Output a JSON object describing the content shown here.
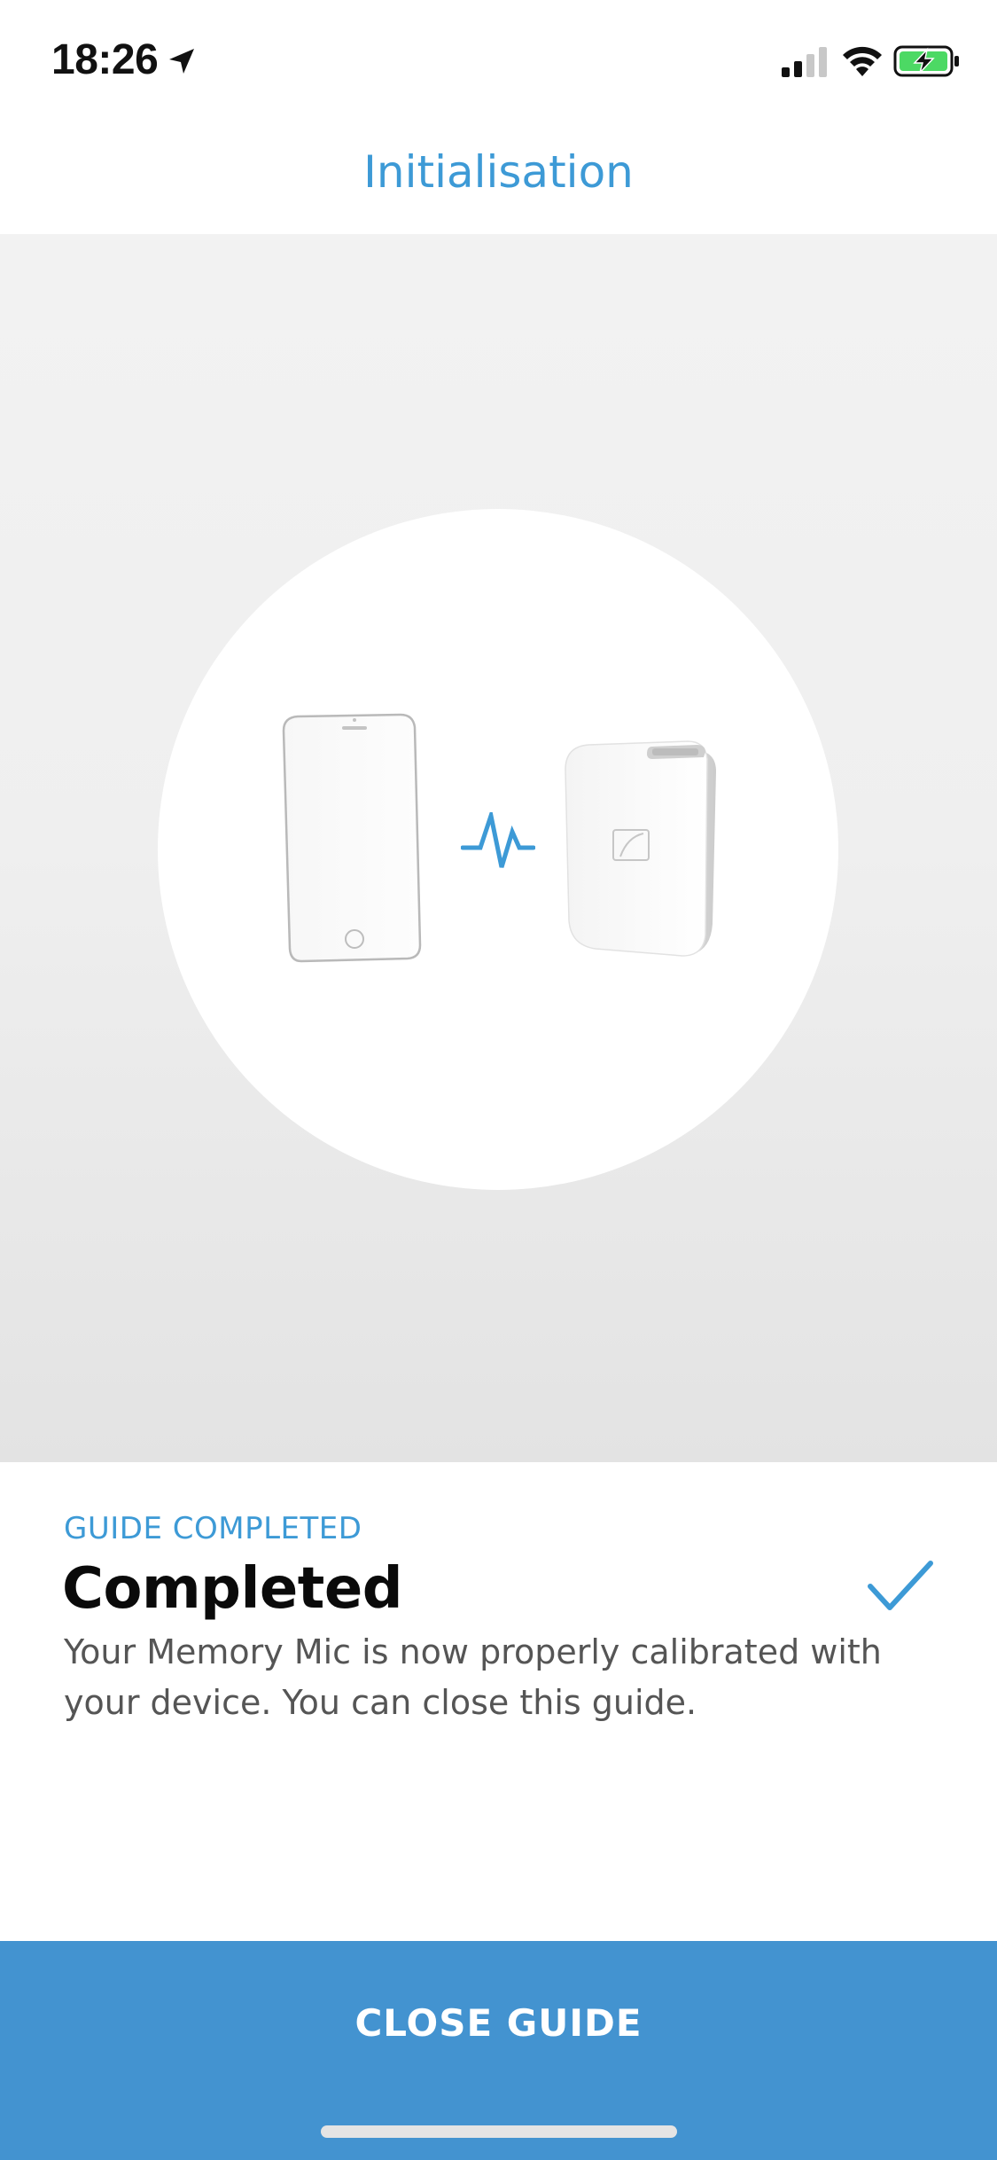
{
  "status_bar": {
    "time": "18:26"
  },
  "header": {
    "title": "Initialisation"
  },
  "illustration": {
    "icons": [
      "phone-illustration",
      "connection-icon",
      "memory-mic-illustration"
    ]
  },
  "guide": {
    "step_label": "GUIDE COMPLETED",
    "title": "Completed",
    "description": "Your Memory Mic is now properly calibrated with your device. You can close this guide.",
    "status_icon": "checkmark-icon"
  },
  "footer": {
    "close_button_label": "CLOSE GUIDE"
  },
  "colors": {
    "accent": "#3d9ad6",
    "button_background": "#4393d0",
    "battery_green": "#4cd964"
  }
}
